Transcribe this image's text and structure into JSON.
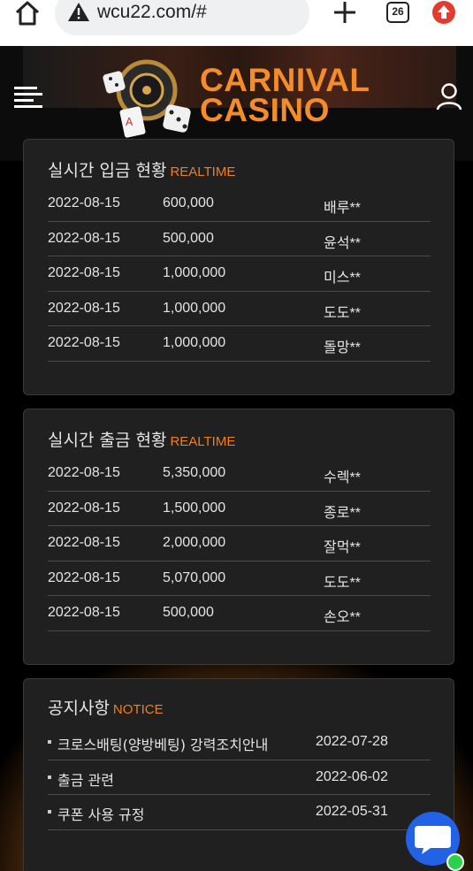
{
  "browser": {
    "url": "wcu22.com/#",
    "tab_count": "26"
  },
  "header": {
    "logo_line1": "CARNIVAL",
    "logo_line2": "CASINO"
  },
  "deposit": {
    "title": "실시간 입금 현황",
    "tag": "REALTIME",
    "rows": [
      {
        "date": "2022-08-15",
        "amount": "600,000",
        "name": "배루**"
      },
      {
        "date": "2022-08-15",
        "amount": "500,000",
        "name": "윤석**"
      },
      {
        "date": "2022-08-15",
        "amount": "1,000,000",
        "name": "미스**"
      },
      {
        "date": "2022-08-15",
        "amount": "1,000,000",
        "name": "도도**"
      },
      {
        "date": "2022-08-15",
        "amount": "1,000,000",
        "name": "돌망**"
      }
    ]
  },
  "withdraw": {
    "title": "실시간 출금 현황",
    "tag": "REALTIME",
    "rows": [
      {
        "date": "2022-08-15",
        "amount": "5,350,000",
        "name": "수렉**"
      },
      {
        "date": "2022-08-15",
        "amount": "1,500,000",
        "name": "종로**"
      },
      {
        "date": "2022-08-15",
        "amount": "2,000,000",
        "name": "잘먹**"
      },
      {
        "date": "2022-08-15",
        "amount": "5,070,000",
        "name": "도도**"
      },
      {
        "date": "2022-08-15",
        "amount": "500,000",
        "name": "손오**"
      }
    ]
  },
  "notice": {
    "title": "공지사항",
    "tag": "NOTICE",
    "items": [
      {
        "title": "크로스배팅(양방베팅) 강력조치안내",
        "date": "2022-07-28"
      },
      {
        "title": "출금 관련",
        "date": "2022-06-02"
      },
      {
        "title": "쿠폰 사용 규정",
        "date": "2022-05-31"
      }
    ]
  },
  "icons": {
    "home": "home-icon",
    "warning": "warning-icon",
    "new_tab": "plus-icon",
    "tabs": "tab-switcher-icon",
    "extension": "upload-arrow-icon",
    "menu": "hamburger-menu-icon",
    "user": "user-icon",
    "chat": "chat-bubble-icon"
  },
  "colors": {
    "accent": "#f17d22",
    "panel_bg": "#202020",
    "chat_button": "#2262e6",
    "online_dot": "#2bd14a"
  }
}
